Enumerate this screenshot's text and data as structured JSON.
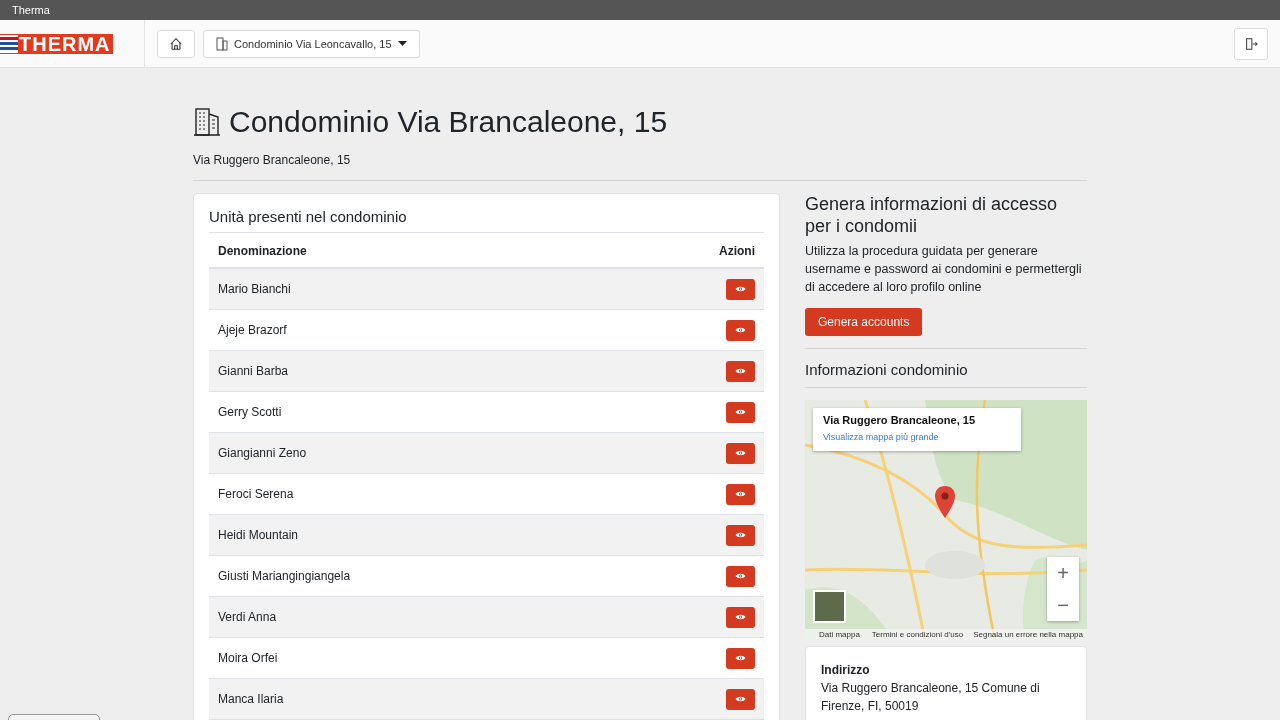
{
  "window": {
    "title": "Therma"
  },
  "navbar": {
    "logo": "THERMA",
    "condominium_selector": "Condominio Via Leoncavallo, 15"
  },
  "header": {
    "title": "Condominio Via Brancaleone, 15",
    "subtitle": "Via Ruggero Brancaleone, 15"
  },
  "units": {
    "title": "Unità presenti nel condominio",
    "columns": [
      "Denominazione",
      "Azioni"
    ],
    "rows": [
      {
        "name": "Mario Bianchi"
      },
      {
        "name": "Ajeje Brazorf"
      },
      {
        "name": "Gianni Barba"
      },
      {
        "name": "Gerry Scotti"
      },
      {
        "name": "Giangianni Zeno"
      },
      {
        "name": "Feroci Serena"
      },
      {
        "name": "Heidi Mountain"
      },
      {
        "name": "Giusti Mariangingiangela"
      },
      {
        "name": "Verdi Anna"
      },
      {
        "name": "Moira Orfei"
      },
      {
        "name": "Manca Ilaria"
      }
    ]
  },
  "access": {
    "title": "Genera informazioni di accesso per i condomii",
    "text": "Utilizza la procedura guidata per generare username e password ai condomini e permettergli di accedere al loro profilo online",
    "button": "Genera accounts"
  },
  "info": {
    "title": "Informazioni condominio",
    "map": {
      "place_title": "Via Ruggero Brancaleone, 15",
      "larger_map_link": "Visualizza mappa più grande",
      "zoom_in": "+",
      "zoom_out": "−",
      "footer_links": [
        "Dati mappa",
        "Termini e condizioni d'uso",
        "Segnala un errore nella mappa"
      ]
    },
    "address": {
      "label": "Indirizzo",
      "value": "Via Ruggero Brancaleone, 15 Comune di Firenze, FI, 50019"
    }
  }
}
